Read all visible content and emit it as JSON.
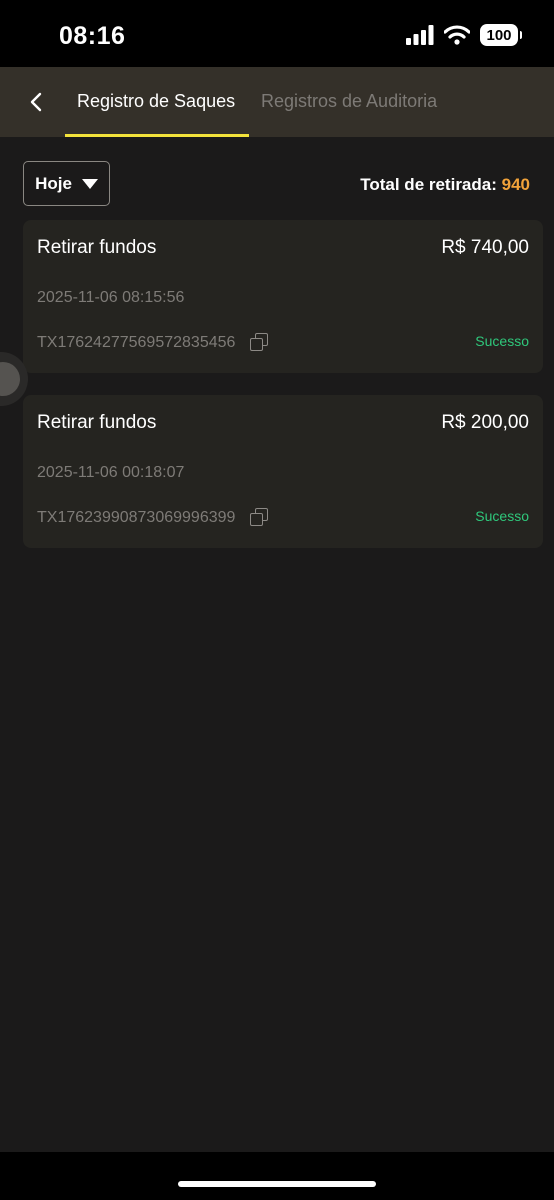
{
  "status_bar": {
    "time": "08:16",
    "battery": "100"
  },
  "header": {
    "tabs": [
      {
        "label": "Registro de Saques",
        "active": true
      },
      {
        "label": "Registros de Auditoria",
        "active": false
      }
    ]
  },
  "filter": {
    "selected": "Hoje"
  },
  "summary": {
    "total_label": "Total de retirada:",
    "total_value": "940"
  },
  "records": [
    {
      "title": "Retirar fundos",
      "amount": "R$ 740,00",
      "date": "2025-11-06 08:15:56",
      "tx_id": "TX17624277569572835456",
      "status": "Sucesso"
    },
    {
      "title": "Retirar fundos",
      "amount": "R$ 200,00",
      "date": "2025-11-06 00:18:07",
      "tx_id": "TX17623990873069996399",
      "status": "Sucesso"
    }
  ],
  "colors": {
    "accent": "#f3e33b",
    "total_value": "#f2a33a",
    "success": "#2fc77b"
  }
}
